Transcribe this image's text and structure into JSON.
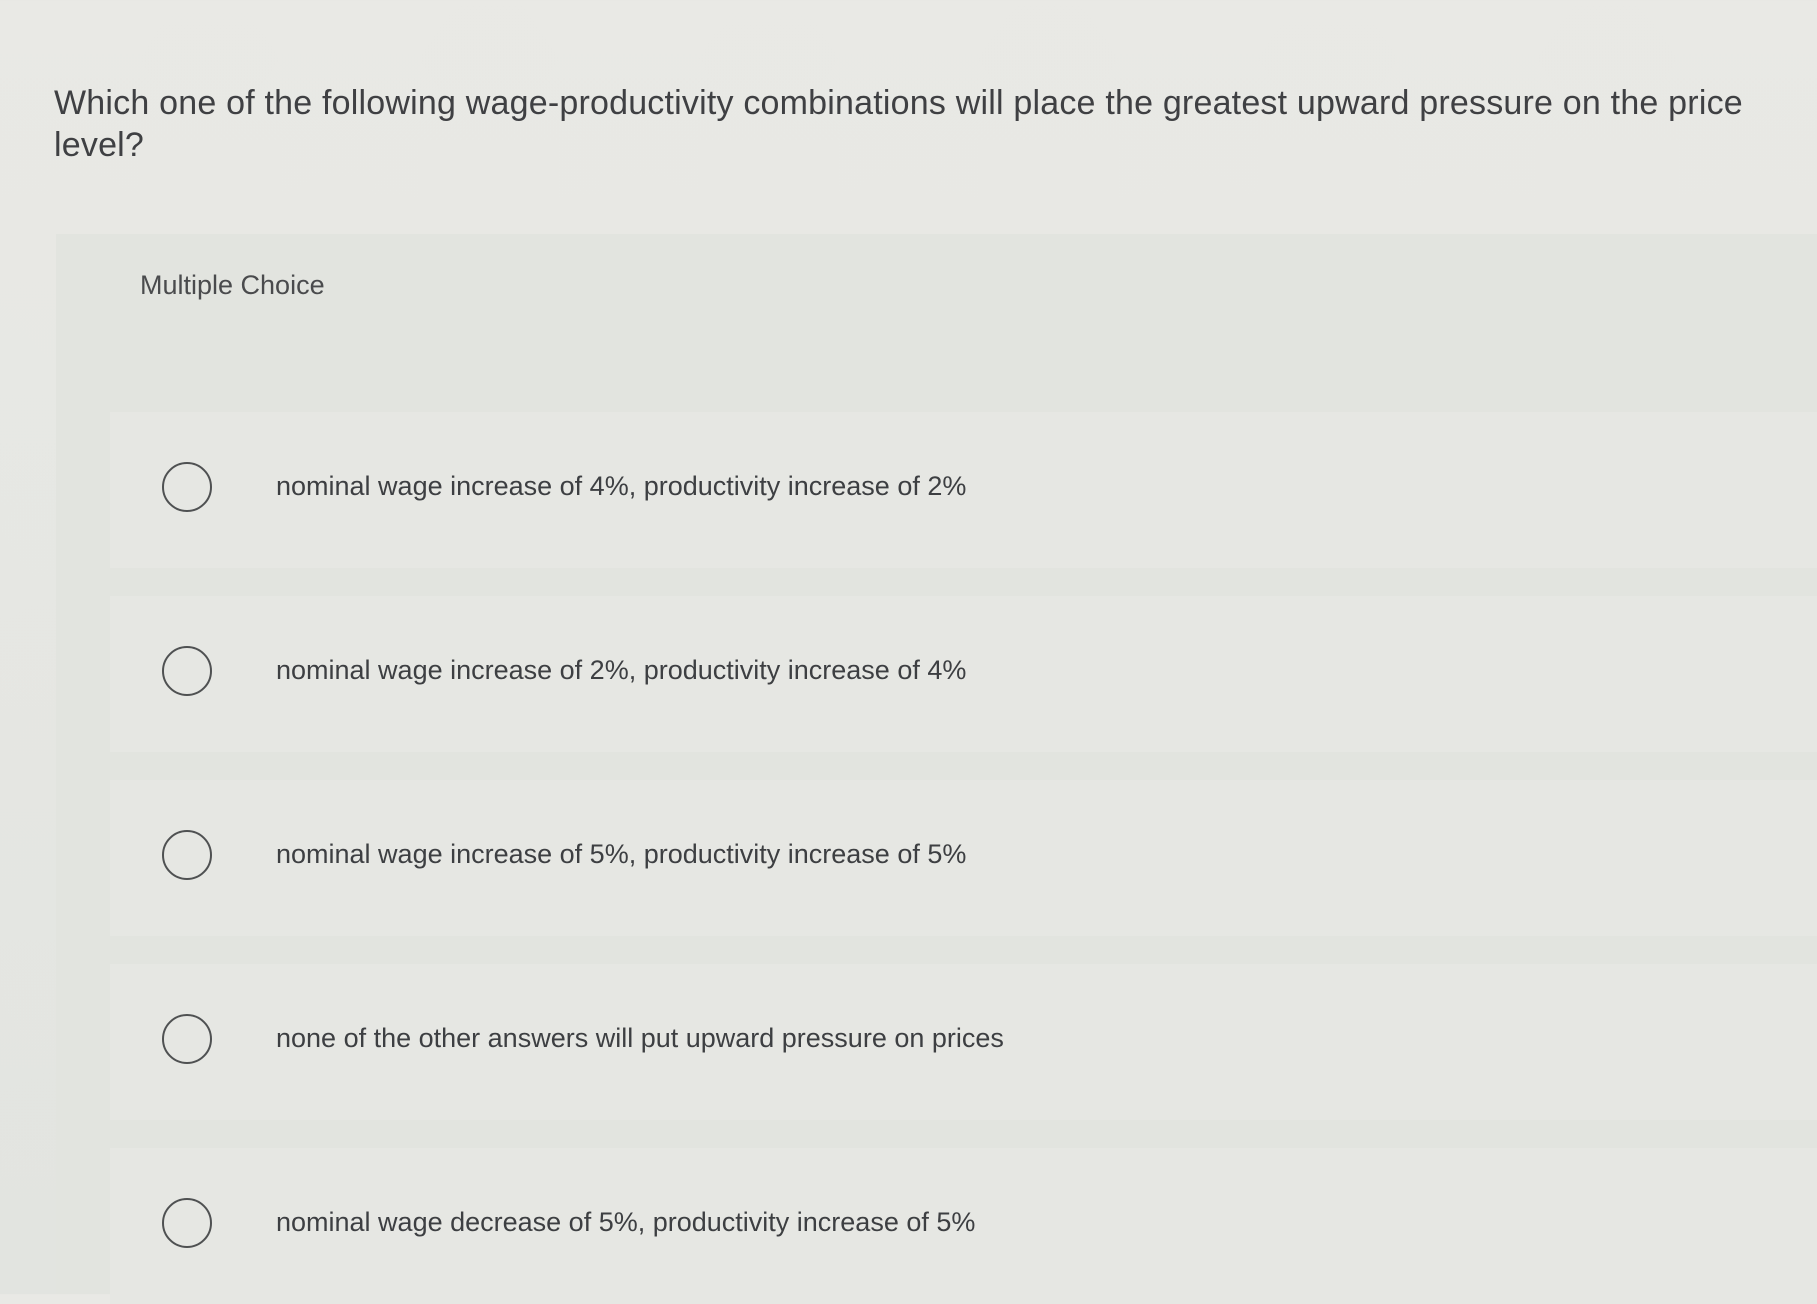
{
  "question": {
    "text": "Which one of the following wage-productivity combinations will place the greatest upward pressure on the price level?"
  },
  "panel": {
    "title": "Multiple Choice"
  },
  "choices": [
    {
      "label": "nominal wage increase of 4%, productivity increase of 2%",
      "selected": false
    },
    {
      "label": "nominal wage increase of 2%, productivity increase of 4%",
      "selected": false
    },
    {
      "label": "nominal wage increase of 5%, productivity increase of 5%",
      "selected": false
    },
    {
      "label": "none of the other answers will put upward pressure on prices",
      "selected": false
    },
    {
      "label": "nominal wage decrease of 5%, productivity increase of 5%",
      "selected": false
    }
  ],
  "colors": {
    "background": "#e7e7e3",
    "text": "#3f4043",
    "radio_border": "#4f5152"
  },
  "icons": {
    "radio": "radio-button-icon"
  }
}
